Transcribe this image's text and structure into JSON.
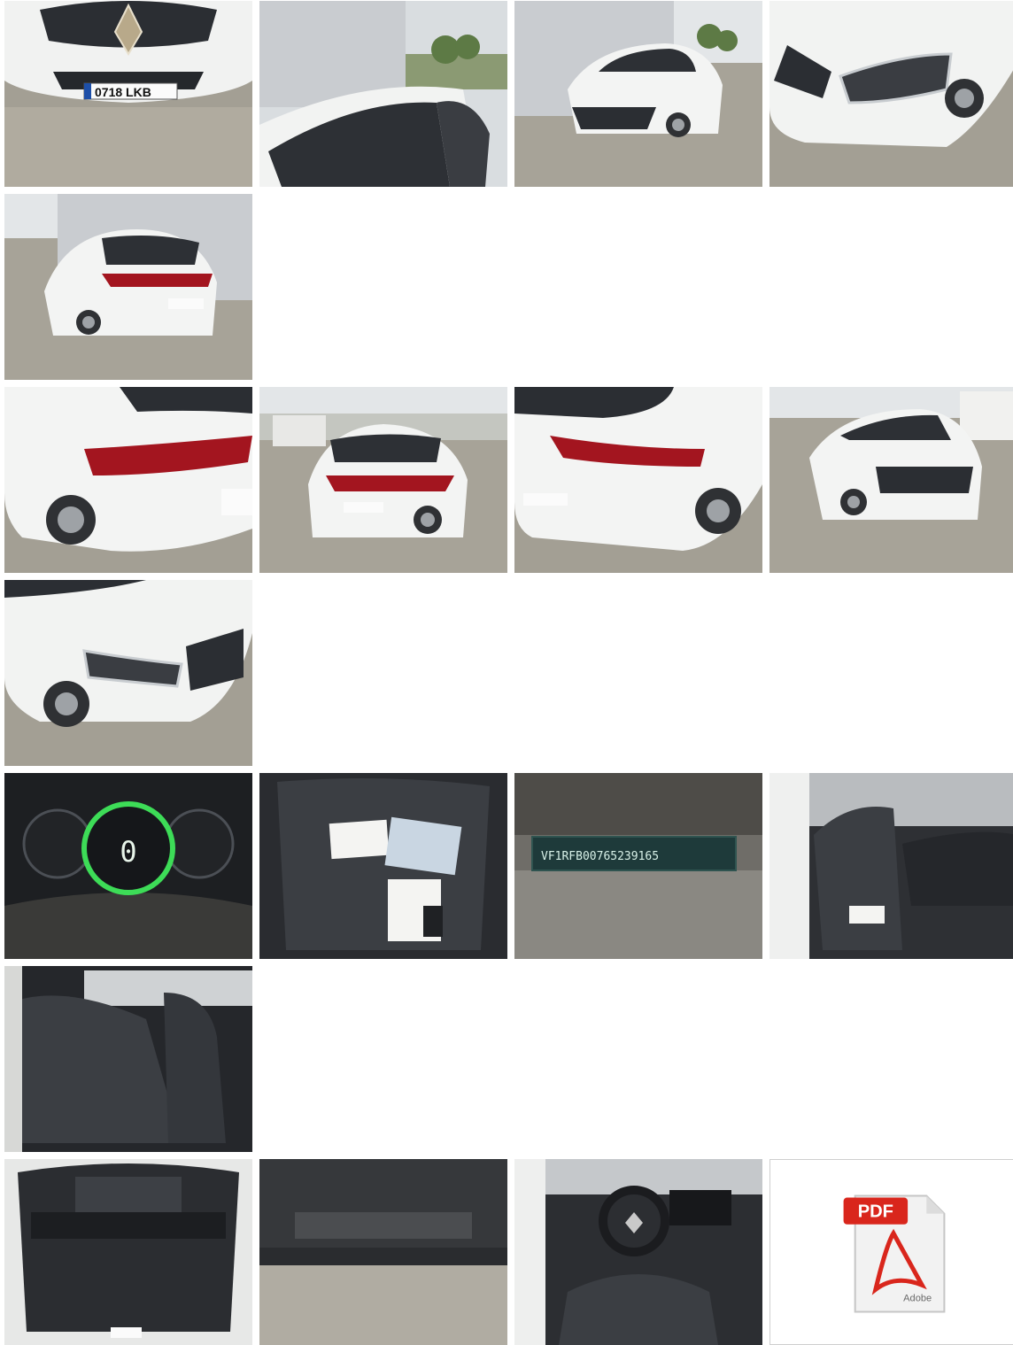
{
  "gallery": {
    "photos": [
      {
        "icon": "car-front-grille-photo",
        "plate": "0718 LKB"
      },
      {
        "icon": "car-windshield-photo"
      },
      {
        "icon": "car-front-three-quarter-photo"
      },
      {
        "icon": "car-headlight-closeup-photo"
      },
      {
        "icon": "car-rear-three-quarter-photo"
      },
      {
        "icon": "car-rear-light-closeup-photo"
      },
      {
        "icon": "car-rear-view-photo"
      },
      {
        "icon": "car-rear-corner-photo"
      },
      {
        "icon": "car-front-right-photo"
      },
      {
        "icon": "car-front-left-corner-photo"
      },
      {
        "icon": "instrument-cluster-photo",
        "gauge": "0"
      },
      {
        "icon": "seat-with-documents-photo"
      },
      {
        "icon": "vin-plate-photo",
        "vin": "VF1RFB00765239165"
      },
      {
        "icon": "front-interior-photo"
      },
      {
        "icon": "rear-seats-photo"
      },
      {
        "icon": "trunk-photo"
      },
      {
        "icon": "underbody-photo"
      },
      {
        "icon": "dashboard-photo"
      },
      {
        "icon": "pdf-document-icon",
        "label": "PDF",
        "brand": "Adobe"
      }
    ]
  },
  "colors": {
    "paint_white": "#f4f5f4",
    "tail_light": "#a3151f",
    "grille": "#2b2e33",
    "ground": "#a39f94",
    "wall": "#c9ccd0",
    "pdf_red": "#d9261c",
    "cluster_green": "#3ddc57"
  }
}
